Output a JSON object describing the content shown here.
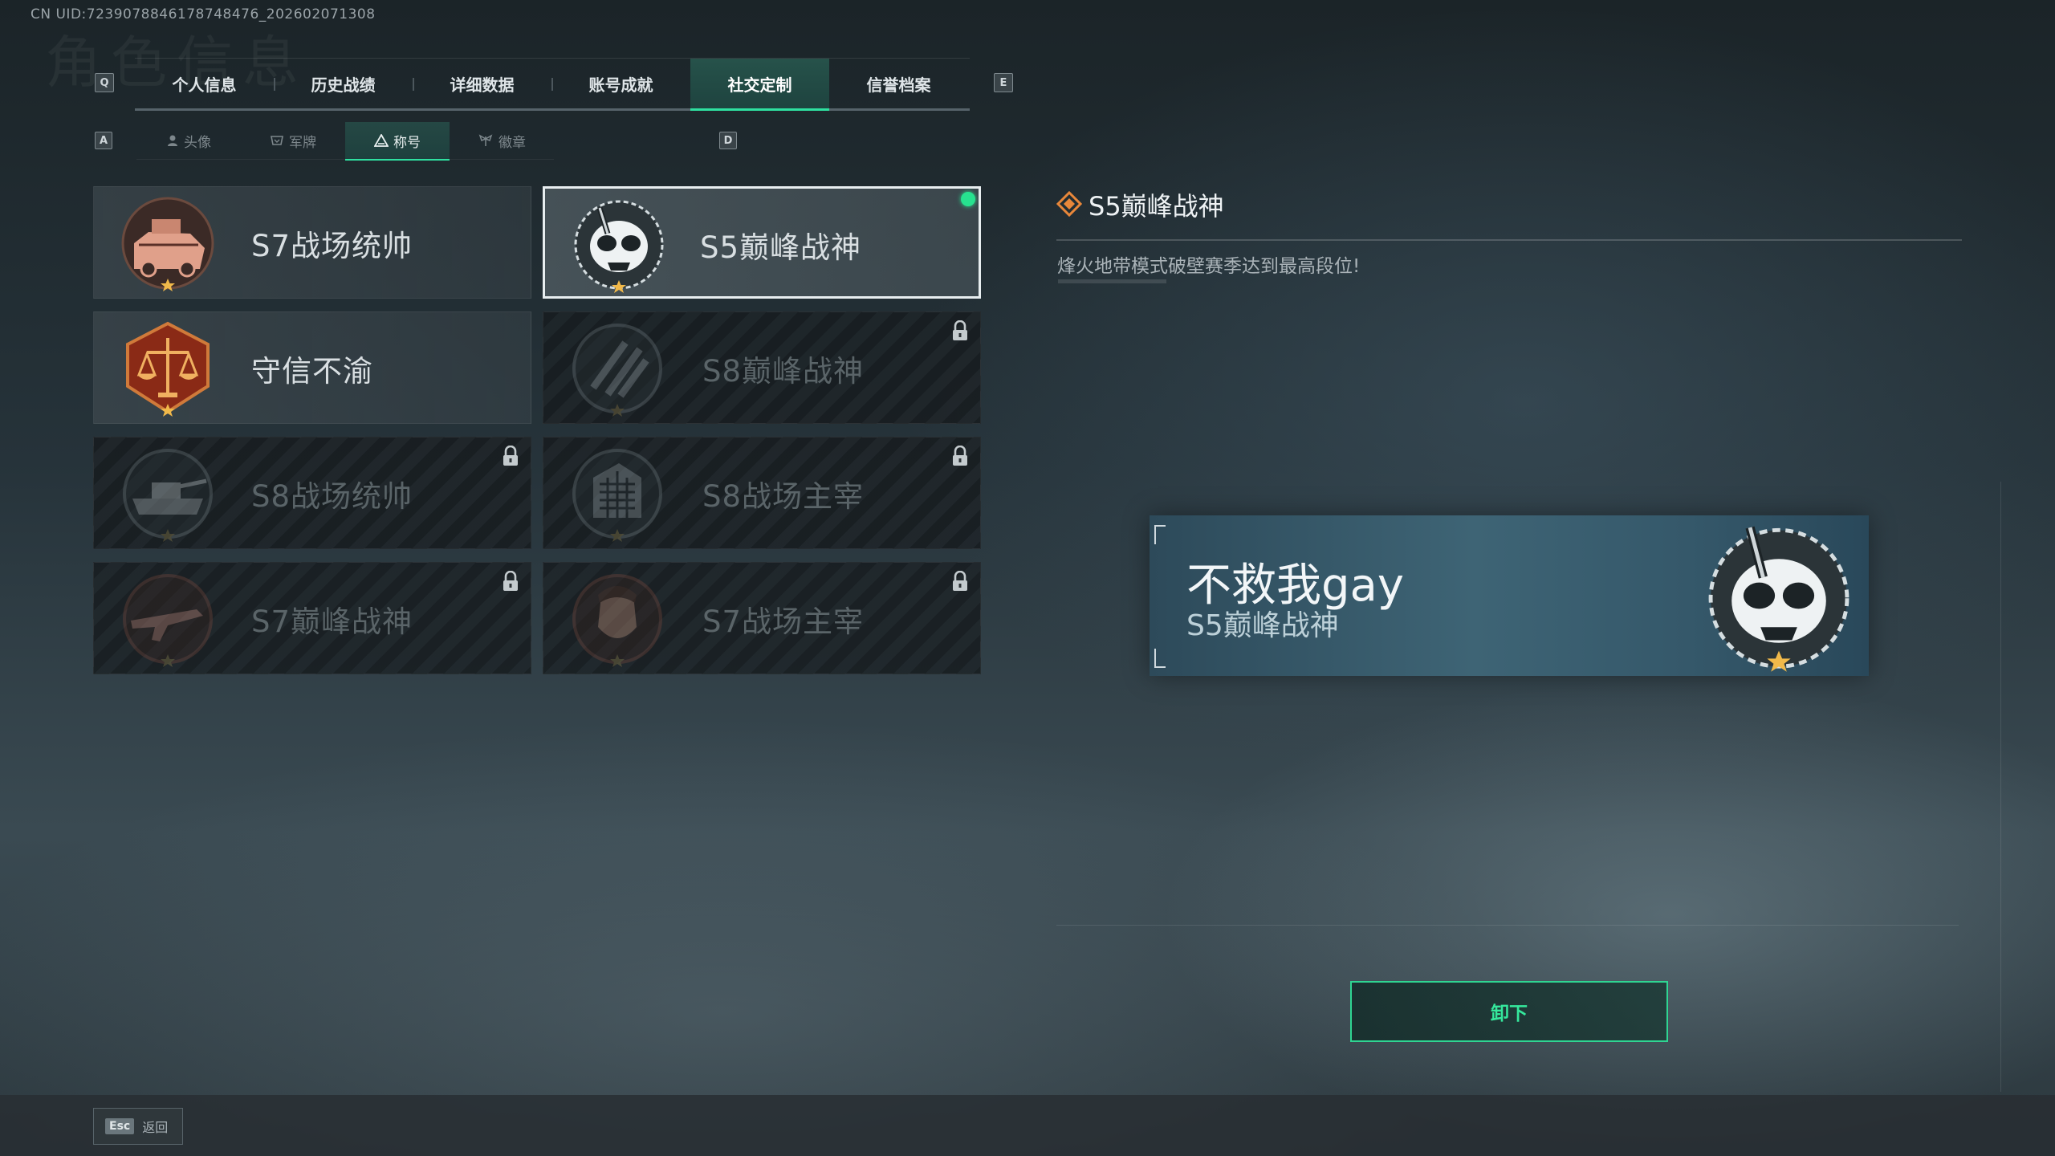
{
  "uid_text": "CN UID:7239078846178748476_202602071308",
  "header_watermark": "角色信息",
  "tabs": {
    "prev_key": "Q",
    "next_key": "E",
    "items": [
      "个人信息",
      "历史战绩",
      "详细数据",
      "账号成就",
      "社交定制",
      "信誉档案"
    ],
    "active": "社交定制"
  },
  "subtabs": {
    "prev_key": "A",
    "next_key": "D",
    "items": [
      "头像",
      "军牌",
      "称号",
      "徽章"
    ],
    "active": "称号"
  },
  "titles": [
    {
      "name": "S7战场统帅",
      "state": "owned",
      "icon": "armored-vehicle-emblem"
    },
    {
      "name": "S5巅峰战神",
      "state": "selected-equipped",
      "icon": "gasmask-skull-emblem"
    },
    {
      "name": "守信不渝",
      "state": "owned",
      "icon": "scales-of-justice-emblem"
    },
    {
      "name": "S8巅峰战神",
      "state": "locked",
      "icon": "slashes-emblem"
    },
    {
      "name": "S8战场统帅",
      "state": "locked",
      "icon": "tank-emblem"
    },
    {
      "name": "S8战场主宰",
      "state": "locked",
      "icon": "building-emblem"
    },
    {
      "name": "S7巅峰战神",
      "state": "locked",
      "icon": "rifle-emblem"
    },
    {
      "name": "S7战场主宰",
      "state": "locked",
      "icon": "soldier-portrait-emblem"
    }
  ],
  "detail": {
    "title": "S5巅峰战神",
    "description": "烽火地带模式破壁赛季达到最高段位!"
  },
  "nameplate": {
    "player_name": "不救我gay",
    "title": "S5巅峰战神"
  },
  "unequip_label": "卸下",
  "footer": {
    "key": "Esc",
    "label": "返回"
  },
  "colors": {
    "accent": "#2fe0a0",
    "equipped_dot": "#27e28f",
    "detail_icon": "#e8873a"
  }
}
